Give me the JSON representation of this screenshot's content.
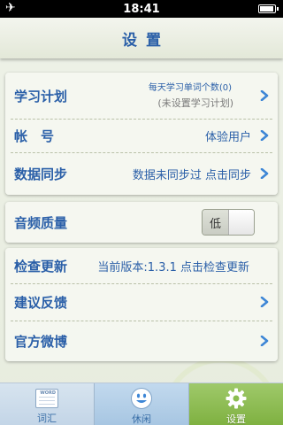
{
  "status": {
    "time": "18:41"
  },
  "header": {
    "title": "设置"
  },
  "rows": {
    "plan": {
      "label": "学习计划",
      "line1": "每天学习单词个数(0)",
      "line2": "(未设置学习计划)"
    },
    "account": {
      "label": "帐　号",
      "value": "体验用户"
    },
    "sync": {
      "label": "数据同步",
      "value": "数据未同步过 点击同步"
    },
    "audio": {
      "label": "音频质量",
      "toggle_value": "低"
    },
    "update": {
      "label": "检查更新",
      "value": "当前版本:1.3.1 点击检查更新"
    },
    "feedback": {
      "label": "建议反馈"
    },
    "weibo": {
      "label": "官方微博"
    }
  },
  "tabs": [
    {
      "label": "词汇",
      "icon": "word-book-icon",
      "icon_text": "WORD"
    },
    {
      "label": "休闲",
      "icon": "smiley-icon"
    },
    {
      "label": "设置",
      "icon": "gear-icon",
      "active": true
    }
  ],
  "colors": {
    "accent": "#2a5fa8",
    "active_tab": "#8bbd4f"
  }
}
